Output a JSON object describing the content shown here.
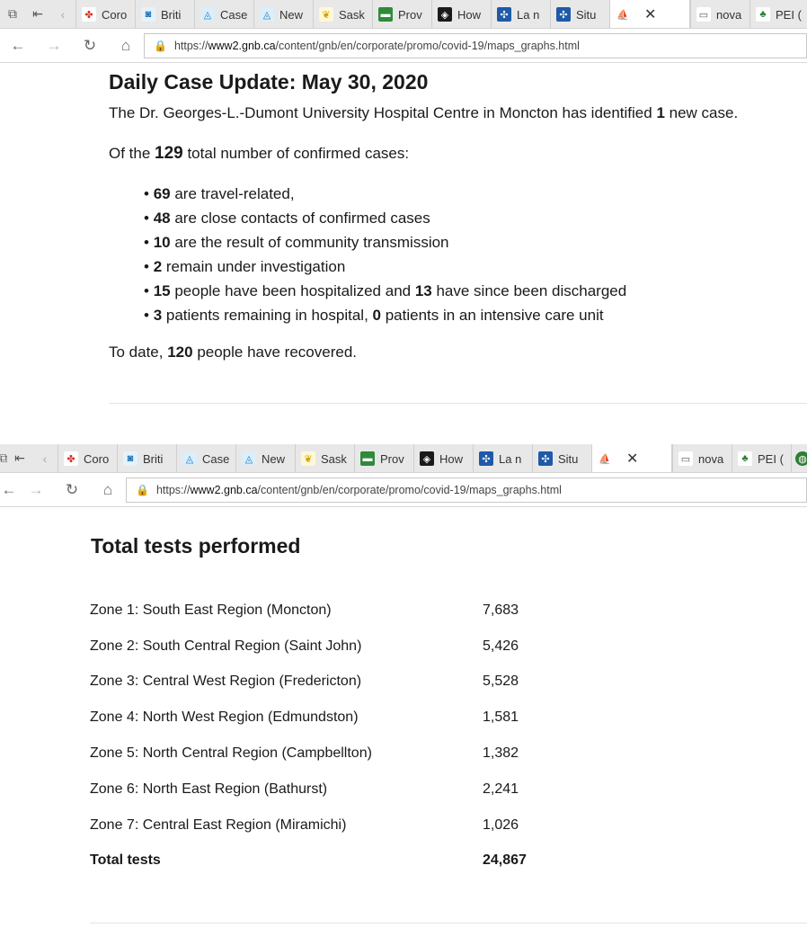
{
  "browser1": {
    "tabs": [
      {
        "label": "Coro",
        "icon": "maple-leaf-icon"
      },
      {
        "label": "Briti",
        "icon": "bc-icon"
      },
      {
        "label": "Case",
        "icon": "alberta-icon"
      },
      {
        "label": "New",
        "icon": "alberta-icon"
      },
      {
        "label": "Sask",
        "icon": "sask-icon"
      },
      {
        "label": "Prov",
        "icon": "manitoba-icon"
      },
      {
        "label": "How",
        "icon": "ontario-icon"
      },
      {
        "label": "La n",
        "icon": "quebec-icon"
      },
      {
        "label": "Situ",
        "icon": "quebec-icon"
      },
      {
        "label": "",
        "icon": "nb-icon"
      },
      {
        "label": "nova",
        "icon": "ns-icon"
      },
      {
        "label": "PEI (",
        "icon": "pei-icon"
      }
    ],
    "url_prefix": "https://",
    "url_host": "www2.gnb.ca",
    "url_path": "/content/gnb/en/corporate/promo/covid-19/maps_graphs.html"
  },
  "browser2": {
    "tabs": [
      {
        "label": "Coro",
        "icon": "maple-leaf-icon"
      },
      {
        "label": "Briti",
        "icon": "bc-icon"
      },
      {
        "label": "Case",
        "icon": "alberta-icon"
      },
      {
        "label": "New",
        "icon": "alberta-icon"
      },
      {
        "label": "Sask",
        "icon": "sask-icon"
      },
      {
        "label": "Prov",
        "icon": "manitoba-icon"
      },
      {
        "label": "How",
        "icon": "ontario-icon"
      },
      {
        "label": "La n",
        "icon": "quebec-icon"
      },
      {
        "label": "Situ",
        "icon": "quebec-icon"
      },
      {
        "label": "",
        "icon": "nb-icon"
      },
      {
        "label": "nova",
        "icon": "ns-icon"
      },
      {
        "label": "PEI (",
        "icon": "pei-icon"
      }
    ],
    "url_prefix": "https://",
    "url_host": "www2.gnb.ca",
    "url_path": "/content/gnb/en/corporate/promo/covid-19/maps_graphs.html"
  },
  "update": {
    "title": "Daily Case Update: May 30, 2020",
    "intro_before": "The Dr. Georges-L.-Dumont University Hospital Centre in Moncton has identified ",
    "intro_num": "1",
    "intro_after": " new case.",
    "total_before": "Of the ",
    "total_num": "129",
    "total_after": " total number of confirmed cases:",
    "bullets": [
      {
        "n1": "69",
        "t1": " are travel-related,",
        "n2": "",
        "t2": ""
      },
      {
        "n1": "48",
        "t1": " are close contacts of confirmed cases",
        "n2": "",
        "t2": ""
      },
      {
        "n1": "10",
        "t1": " are the result of community transmission",
        "n2": "",
        "t2": ""
      },
      {
        "n1": "2",
        "t1": " remain under investigation",
        "n2": "",
        "t2": ""
      },
      {
        "n1": "15",
        "t1": " people have been hospitalized and ",
        "n2": "13",
        "t2": " have since been discharged"
      },
      {
        "n1": "3",
        "t1": " patients remaining in hospital, ",
        "n2": "0",
        "t2": " patients in an intensive care unit"
      }
    ],
    "recovered_before": "To date, ",
    "recovered_num": "120",
    "recovered_after": " people have recovered."
  },
  "tests": {
    "title": "Total tests performed",
    "rows": [
      {
        "zone": "Zone 1: South East Region (Moncton)",
        "value": "7,683"
      },
      {
        "zone": "Zone 2: South Central Region (Saint John)",
        "value": "5,426"
      },
      {
        "zone": "Zone 3: Central West Region (Fredericton)",
        "value": "5,528"
      },
      {
        "zone": "Zone 4: North West Region (Edmundston)",
        "value": "1,581"
      },
      {
        "zone": "Zone 5: North Central Region (Campbellton)",
        "value": "1,382"
      },
      {
        "zone": "Zone 6: North East Region (Bathurst)",
        "value": "2,241"
      },
      {
        "zone": "Zone 7: Central East Region (Miramichi)",
        "value": "1,026"
      }
    ],
    "total_label": "Total tests",
    "total_value": "24,867"
  },
  "colors": {
    "tabbar_bg": "#e8e8e8",
    "text": "#1a1a1a"
  }
}
